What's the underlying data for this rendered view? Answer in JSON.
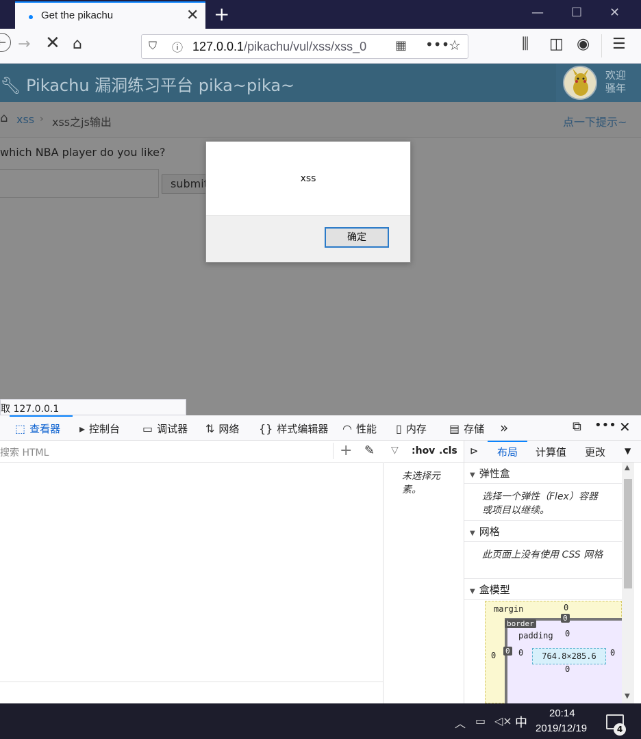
{
  "browser": {
    "tab_title": "Get the pikachu",
    "url_host": "127.0.0.1",
    "url_path": "/pikachu/vul/xss/xss_0",
    "status_text": "取 127.0.0.1"
  },
  "site": {
    "title": "Pikachu 漏洞练习平台 pika~pika~",
    "welcome_line1": "欢迎",
    "welcome_line2": "骚年",
    "breadcrumb_link": "xss",
    "breadcrumb_current": "xss之js输出",
    "hint_link": "点一下提示~",
    "question": "which NBA player do you like?",
    "submit_label": "submit"
  },
  "dialog": {
    "message": "xss",
    "ok_label": "确定"
  },
  "devtools": {
    "tabs": [
      "查看器",
      "控制台",
      "调试器",
      "网络",
      "样式编辑器",
      "性能",
      "内存",
      "存储"
    ],
    "search_placeholder": "搜索 HTML",
    "hov": ":hov",
    "cls": ".cls",
    "no_element": "未选择元素。",
    "layout_tabs": [
      "布局",
      "计算值",
      "更改"
    ],
    "flex_title": "弹性盒",
    "flex_body": "选择一个弹性（Flex）容器或项目以继续。",
    "grid_title": "网格",
    "grid_body": "此页面上没有使用 CSS 网格",
    "boxmodel_title": "盒模型",
    "boxmodel": {
      "margin_label": "margin",
      "border_label": "border",
      "padding_label": "padding",
      "content_size": "764.8×285.6",
      "margin_top": "0",
      "border_top": "0",
      "padding_top": "0",
      "margin_left": "0",
      "border_left": "0",
      "padding_left": "0",
      "padding_right": "0",
      "padding_bottom": "0"
    }
  },
  "taskbar": {
    "time": "20:14",
    "date": "2019/12/19",
    "ime": "中",
    "notifications": "4"
  },
  "colors": {
    "accent": "#0a84ff",
    "header_bg": "#37627a",
    "overlay_page": "#8c8c8c"
  }
}
